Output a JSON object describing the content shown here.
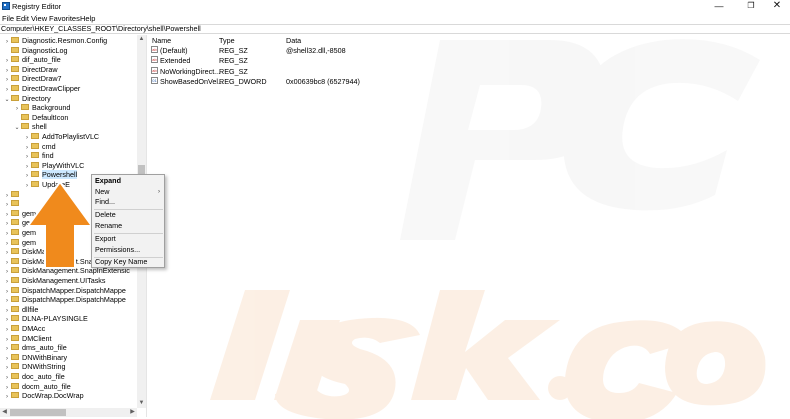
{
  "window": {
    "title": "Registry Editor",
    "controls": {
      "minimize": "—",
      "maximize": "❐",
      "close": "✕"
    }
  },
  "menu": [
    "File",
    "Edit",
    "View",
    "Favorites",
    "Help"
  ],
  "address": "Computer\\HKEY_CLASSES_ROOT\\Directory\\shell\\Powershell",
  "tree": [
    {
      "label": "Diagnostic.Resmon.Config",
      "expander": "›"
    },
    {
      "label": "DiagnosticLog",
      "expander": ""
    },
    {
      "label": "dif_auto_file",
      "expander": "›"
    },
    {
      "label": "DirectDraw",
      "expander": "›"
    },
    {
      "label": "DirectDraw7",
      "expander": "›"
    },
    {
      "label": "DirectDrawClipper",
      "expander": "›"
    },
    {
      "label": "Directory",
      "expander": "⌄"
    },
    {
      "label": "Background",
      "expander": "›"
    },
    {
      "label": "DefaultIcon",
      "expander": ""
    },
    {
      "label": "shell",
      "expander": "⌄"
    },
    {
      "label": "AddToPlaylistVLC",
      "expander": "›"
    },
    {
      "label": "cmd",
      "expander": "›"
    },
    {
      "label": "find",
      "expander": "›"
    },
    {
      "label": "PlayWithVLC",
      "expander": "›"
    },
    {
      "label": "Powershell",
      "expander": "›"
    },
    {
      "label": "UpdateE",
      "expander": "›"
    },
    {
      "label": "",
      "expander": "›"
    },
    {
      "label": "",
      "expander": "›"
    },
    {
      "label": "gem",
      "expander": "›"
    },
    {
      "label": "gem",
      "expander": "›"
    },
    {
      "label": "gem",
      "expander": "›"
    },
    {
      "label": "gem",
      "expander": "›"
    },
    {
      "label": "DiskManagem",
      "expander": "›"
    },
    {
      "label": "DiskManagement.SnapInCompo",
      "expander": "›"
    },
    {
      "label": "DiskManagement.SnapInExtensic",
      "expander": "›"
    },
    {
      "label": "DiskManagement.UITasks",
      "expander": "›"
    },
    {
      "label": "DispatchMapper.DispatchMappe",
      "expander": "›"
    },
    {
      "label": "DispatchMapper.DispatchMappe",
      "expander": "›"
    },
    {
      "label": "dllfile",
      "expander": "›"
    },
    {
      "label": "DLNA-PLAYSINGLE",
      "expander": "›"
    },
    {
      "label": "DMAcc",
      "expander": "›"
    },
    {
      "label": "DMClient",
      "expander": "›"
    },
    {
      "label": "dms_auto_file",
      "expander": "›"
    },
    {
      "label": "DNWithBinary",
      "expander": "›"
    },
    {
      "label": "DNWithString",
      "expander": "›"
    },
    {
      "label": "doc_auto_file",
      "expander": "›"
    },
    {
      "label": "docm_auto_file",
      "expander": "›"
    },
    {
      "label": "DocWrap.DocWrap",
      "expander": "›"
    }
  ],
  "columns": {
    "name": "Name",
    "type": "Type",
    "data": "Data"
  },
  "values": [
    {
      "icon": "ab",
      "name": "(Default)",
      "type": "REG_SZ",
      "data": "@shell32.dll,-8508"
    },
    {
      "icon": "ab",
      "name": "Extended",
      "type": "REG_SZ",
      "data": ""
    },
    {
      "icon": "ab",
      "name": "NoWorkingDirect...",
      "type": "REG_SZ",
      "data": ""
    },
    {
      "icon": "01",
      "name": "ShowBasedOnVel...",
      "type": "REG_DWORD",
      "data": "0x00639bc8 (6527944)"
    }
  ],
  "context_menu": {
    "expand": "Expand",
    "new": "New",
    "find": "Find...",
    "delete": "Delete",
    "rename": "Rename",
    "export": "Export",
    "permissions": "Permissions...",
    "copy_key_name": "Copy Key Name",
    "submenu_arrow": "›"
  },
  "scroll_glyphs": {
    "up": "▲",
    "down": "▼",
    "left": "◀",
    "right": "▶"
  },
  "colors": {
    "selection": "#cce8ff",
    "menu_bg": "#f2f2f2",
    "arrow": "#f08a1c",
    "folder": "#e8c35a"
  }
}
